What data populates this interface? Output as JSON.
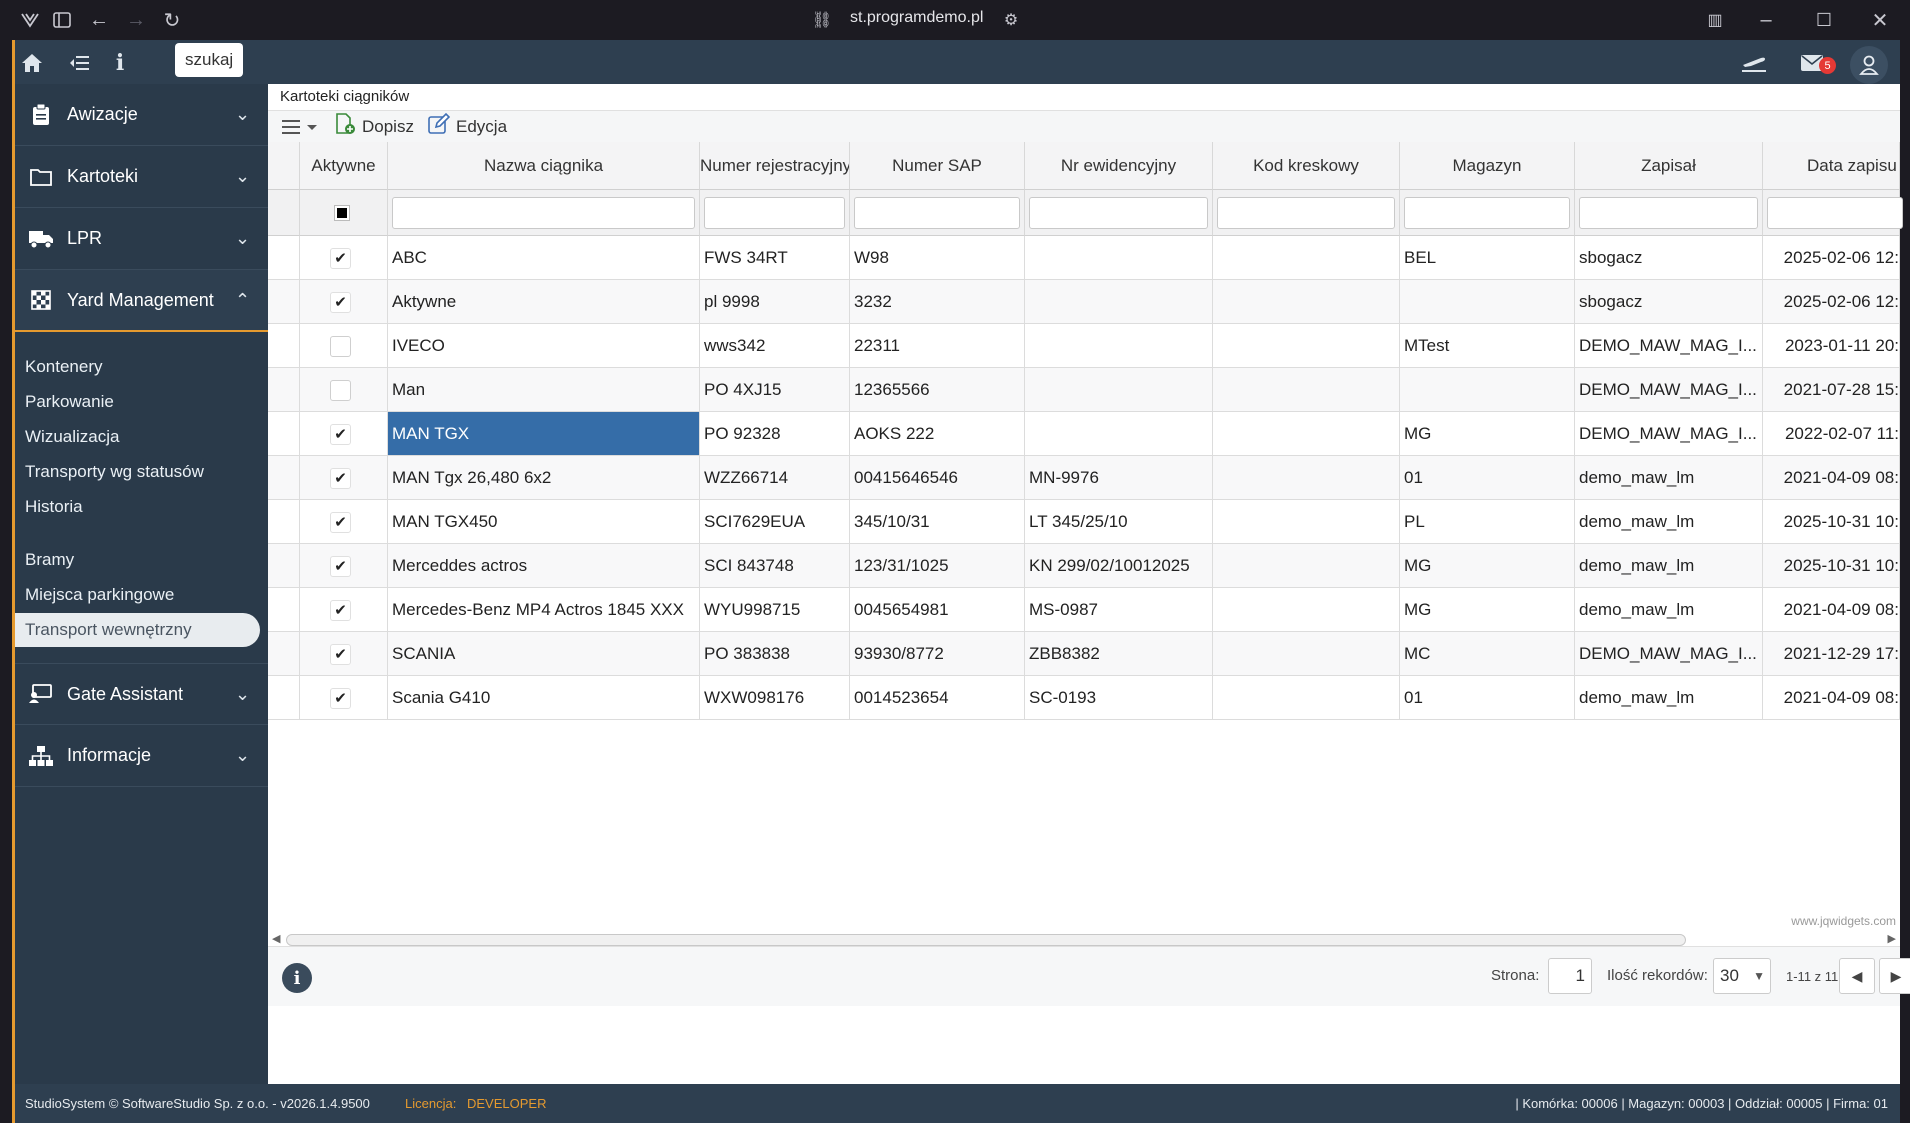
{
  "browser": {
    "url": "st.programdemo.pl"
  },
  "topbar": {
    "search_label": "szukaj",
    "mail_count": "5"
  },
  "sidebar": {
    "groups": [
      {
        "label": "Awizacje",
        "icon": "clipboard-icon"
      },
      {
        "label": "Kartoteki",
        "icon": "folder-icon"
      },
      {
        "label": "LPR",
        "icon": "truck-icon"
      },
      {
        "label": "Yard Management",
        "icon": "checkered-flag-icon"
      },
      {
        "label": "Gate Assistant",
        "icon": "gate-assistant-icon"
      },
      {
        "label": "Informacje",
        "icon": "sitemap-icon"
      }
    ],
    "yard_items": [
      "Kontenery",
      "Parkowanie",
      "Wizualizacja",
      "Transporty wg statusów",
      "Historia"
    ],
    "yard_items2": [
      "Bramy",
      "Miejsca parkingowe",
      "Transport wewnętrzny"
    ]
  },
  "content": {
    "title": "Kartoteki ciągników",
    "add_label": "Dopisz",
    "edit_label": "Edycja"
  },
  "grid": {
    "columns": [
      "Aktywne",
      "Nazwa ciągnika",
      "Numer rejestracyjny",
      "Numer SAP",
      "Nr ewidencyjny",
      "Kod kreskowy",
      "Magazyn",
      "Zapisał",
      "Data zapisu"
    ],
    "rows": [
      {
        "active": true,
        "name": "ABC",
        "reg": "FWS 34RT",
        "sap": "W98",
        "ewid": "",
        "barcode": "",
        "mag": "BEL",
        "user": "sbogacz",
        "date": "2025-02-06 12:"
      },
      {
        "active": true,
        "name": "Aktywne",
        "reg": "pl 9998",
        "sap": "3232",
        "ewid": "",
        "barcode": "",
        "mag": "",
        "user": "sbogacz",
        "date": "2025-02-06 12:"
      },
      {
        "active": false,
        "name": "IVECO",
        "reg": "wws342",
        "sap": "22311",
        "ewid": "",
        "barcode": "",
        "mag": "MTest",
        "user": "DEMO_MAW_MAG_I...",
        "date": "2023-01-11 20:"
      },
      {
        "active": false,
        "name": "Man",
        "reg": "PO 4XJ15",
        "sap": "12365566",
        "ewid": "",
        "barcode": "",
        "mag": "",
        "user": "DEMO_MAW_MAG_I...",
        "date": "2021-07-28 15:"
      },
      {
        "active": true,
        "name": "MAN TGX",
        "reg": "PO 92328",
        "sap": "AOKS 222",
        "ewid": "",
        "barcode": "",
        "mag": "MG",
        "user": "DEMO_MAW_MAG_I...",
        "date": "2022-02-07 11:"
      },
      {
        "active": true,
        "name": "MAN Tgx 26,480 6x2",
        "reg": "WZZ66714",
        "sap": "00415646546",
        "ewid": "MN-9976",
        "barcode": "",
        "mag": "01",
        "user": "demo_maw_lm",
        "date": "2021-04-09 08:"
      },
      {
        "active": true,
        "name": "MAN TGX450",
        "reg": "SCI7629EUA",
        "sap": "345/10/31",
        "ewid": "LT 345/25/10",
        "barcode": "",
        "mag": "PL",
        "user": "demo_maw_lm",
        "date": "2025-10-31 10:"
      },
      {
        "active": true,
        "name": "Merceddes actros",
        "reg": "SCI 843748",
        "sap": "123/31/1025",
        "ewid": "KN 299/02/10012025",
        "barcode": "",
        "mag": "MG",
        "user": "demo_maw_lm",
        "date": "2025-10-31 10:"
      },
      {
        "active": true,
        "name": "Mercedes-Benz MP4 Actros 1845 XXX",
        "reg": "WYU998715",
        "sap": "0045654981",
        "ewid": "MS-0987",
        "barcode": "",
        "mag": "MG",
        "user": "demo_maw_lm",
        "date": "2021-04-09 08:"
      },
      {
        "active": true,
        "name": "SCANIA",
        "reg": "PO 383838",
        "sap": "93930/8772",
        "ewid": "ZBB8382",
        "barcode": "",
        "mag": "MC",
        "user": "DEMO_MAW_MAG_I...",
        "date": "2021-12-29 17:"
      },
      {
        "active": true,
        "name": "Scania G410",
        "reg": "WXW098176",
        "sap": "0014523654",
        "ewid": "SC-0193",
        "barcode": "",
        "mag": "01",
        "user": "demo_maw_lm",
        "date": "2021-04-09 08:"
      }
    ],
    "selected_row_name": "MAN TGX"
  },
  "pager": {
    "page_label": "Strona:",
    "page_value": "1",
    "records_label": "Ilość rekordów:",
    "records_value": "30",
    "range_text": "1-11 z 11",
    "watermark": "www.jqwidgets.com"
  },
  "statusbar": {
    "left": "StudioSystem © SoftwareStudio Sp. z o.o. - v2026.1.4.9500",
    "license_label": "Licencja:",
    "license_value": "DEVELOPER",
    "right": "| Komórka: 00006 | Magazyn: 00003 | Oddział: 00005 | Firma: 01"
  },
  "colors": {
    "accent": "#e59a2f",
    "sidebar_bg": "#2a3a4a",
    "selection": "#356da8"
  }
}
